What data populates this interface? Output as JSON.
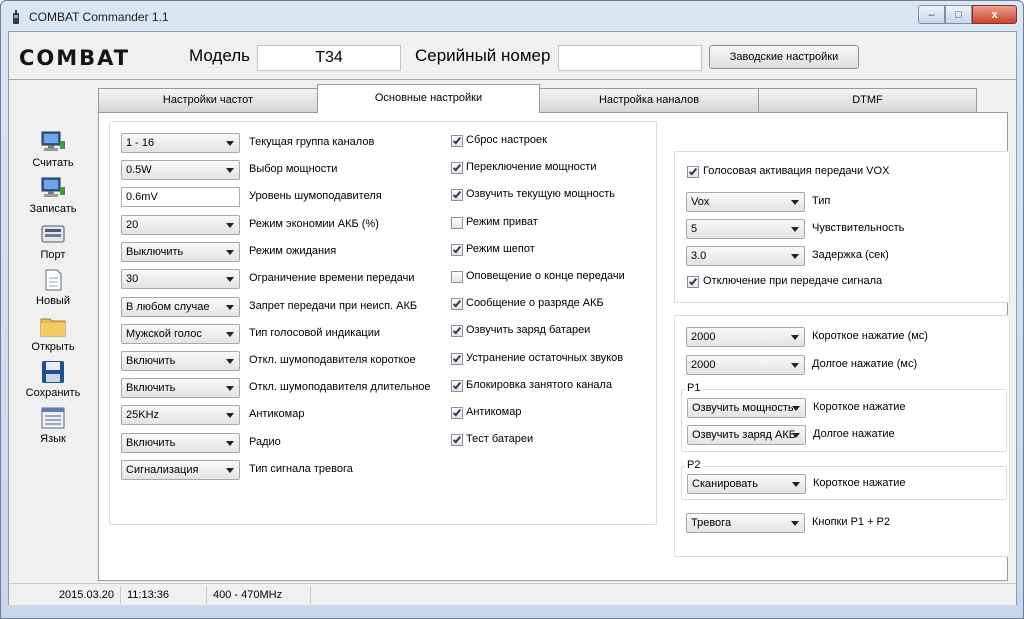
{
  "window": {
    "title": "COMBAT Commander 1.1",
    "minimize_glyph": "–",
    "maximize_glyph": "□",
    "close_glyph": "x"
  },
  "header": {
    "logo": "COMBAT",
    "model_label": "Модель",
    "model_value": "T34",
    "serial_label": "Серийный номер",
    "serial_value": "",
    "factory_button": "Заводские настройки"
  },
  "sidebar": {
    "items": [
      {
        "label": "Считать",
        "icon": "computer-read-icon"
      },
      {
        "label": "Записать",
        "icon": "computer-write-icon"
      },
      {
        "label": "Порт",
        "icon": "port-icon"
      },
      {
        "label": "Новый",
        "icon": "new-document-icon"
      },
      {
        "label": "Открыть",
        "icon": "folder-icon"
      },
      {
        "label": "Сохранить",
        "icon": "floppy-disk-icon"
      },
      {
        "label": "Язык",
        "icon": "language-icon"
      }
    ]
  },
  "tabs": [
    {
      "label": "Настройки частот",
      "active": false
    },
    {
      "label": "Основные настройки",
      "active": true
    },
    {
      "label": "Настройка наналов",
      "active": false
    },
    {
      "label": "DTMF",
      "active": false
    }
  ],
  "basic": {
    "rows": [
      {
        "value": "1 - 16",
        "label": "Текущая группа каналов",
        "kind": "combo"
      },
      {
        "value": "0.5W",
        "label": "Выбор мощности",
        "kind": "combo"
      },
      {
        "value": "0.6mV",
        "label": "Уровень шумоподавителя",
        "kind": "text"
      },
      {
        "value": "20",
        "label": "Режим экономии АКБ (%)",
        "kind": "combo"
      },
      {
        "value": "Выключить",
        "label": "Режим ожидания",
        "kind": "combo"
      },
      {
        "value": "30",
        "label": "Ограничение времени передачи",
        "kind": "combo"
      },
      {
        "value": "В любом случае",
        "label": "Запрет передачи при неисп. АКБ",
        "kind": "combo"
      },
      {
        "value": "Мужской голос",
        "label": "Тип голосовой индикации",
        "kind": "combo"
      },
      {
        "value": "Включить",
        "label": "Откл. шумоподавителя короткое",
        "kind": "combo"
      },
      {
        "value": "Включить",
        "label": "Откл. шумоподавителя длительное",
        "kind": "combo"
      },
      {
        "value": "25KHz",
        "label": "Антикомар",
        "kind": "combo"
      },
      {
        "value": "Включить",
        "label": "Радио",
        "kind": "combo"
      },
      {
        "value": "Сигнализация",
        "label": "Тип сигнала тревога",
        "kind": "combo"
      }
    ],
    "checks": [
      {
        "label": "Сброс настроек",
        "checked": true
      },
      {
        "label": "Переключение мощности",
        "checked": true
      },
      {
        "label": "Озвучить текущую мощность",
        "checked": true
      },
      {
        "label": "Режим приват",
        "checked": false
      },
      {
        "label": "Режим шепот",
        "checked": true
      },
      {
        "label": "Оповещение о конце передачи",
        "checked": false
      },
      {
        "label": "Сообщение о разряде АКБ",
        "checked": true
      },
      {
        "label": "Озвучить заряд батареи",
        "checked": true
      },
      {
        "label": "Устранение остаточных звуков",
        "checked": true
      },
      {
        "label": "Блокировка занятого канала",
        "checked": true
      },
      {
        "label": "Антикомар",
        "checked": true
      },
      {
        "label": "Тест батареи",
        "checked": true
      }
    ]
  },
  "vox": {
    "enable_label": "Голосовая активация передачи VOX",
    "enable_checked": true,
    "rows": [
      {
        "value": "Vox",
        "label": "Тип"
      },
      {
        "value": "5",
        "label": "Чувствительность"
      },
      {
        "value": "3.0",
        "label": "Задержка (сек)"
      }
    ],
    "tx_off_label": "Отключение при передаче сигнала",
    "tx_off_checked": true
  },
  "keys": {
    "short_press": {
      "value": "2000",
      "label": "Короткое нажатие (мс)"
    },
    "long_press": {
      "value": "2000",
      "label": "Долгое нажатие (мс)"
    },
    "p1": {
      "title": "P1",
      "short": {
        "value": "Озвучить мощность",
        "label": "Короткое нажатие"
      },
      "long": {
        "value": "Озвучить заряд АКБ",
        "label": "Долгое нажатие"
      }
    },
    "p2": {
      "title": "P2",
      "short": {
        "value": "Сканировать",
        "label": "Короткое нажатие"
      }
    },
    "p1p2": {
      "value": "Тревога",
      "label": "Кнопки Р1 + Р2"
    }
  },
  "status": {
    "date": "2015.03.20",
    "time": "11:13:36",
    "band": "400 - 470MHz"
  }
}
